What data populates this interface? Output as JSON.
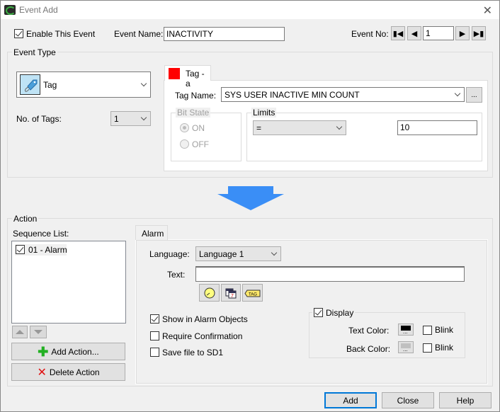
{
  "window": {
    "title": "Event Add",
    "close_icon": "close-icon"
  },
  "header": {
    "enable_label": "Enable This Event",
    "enable_checked": true,
    "event_name_label": "Event Name:",
    "event_name_value": "INACTIVITY",
    "event_no_label": "Event No:",
    "event_no_value": "1",
    "nav": {
      "first": "⏮",
      "prev": "◀",
      "next": "▶",
      "last": "⏭"
    }
  },
  "event_type": {
    "title": "Event Type",
    "type_value": "Tag",
    "type_icon": "tag-icon",
    "num_tags_label": "No. of Tags:",
    "num_tags_value": "1",
    "tab": {
      "label": "Tag - a",
      "color": "#ff0000"
    },
    "tag_name_label": "Tag Name:",
    "tag_name_value": "SYS USER INACTIVE MIN COUNT",
    "browse_label": "...",
    "bit_state": {
      "title": "Bit State",
      "on_label": "ON",
      "off_label": "OFF",
      "selected": "ON"
    },
    "limits": {
      "title": "Limits",
      "operator": "=",
      "value": "10"
    }
  },
  "arrow": {
    "color": "#3a8ef6"
  },
  "action": {
    "title": "Action",
    "sequence_label": "Sequence List:",
    "sequence_items": [
      {
        "label": "01 - Alarm",
        "checked": true
      }
    ],
    "add_action_label": "Add Action...",
    "delete_action_label": "Delete Action",
    "alarm_tab_label": "Alarm",
    "language_label": "Language:",
    "language_value": "Language 1",
    "text_label": "Text:",
    "text_value": "",
    "insert_icons": [
      "clock-icon",
      "calendar-icon",
      "tag-insert-icon"
    ],
    "options": [
      {
        "label": "Show in Alarm Objects",
        "checked": true
      },
      {
        "label": "Require Confirmation",
        "checked": false
      },
      {
        "label": "Save file to SD1",
        "checked": false
      }
    ],
    "display": {
      "label": "Display",
      "checked": true,
      "text_color_label": "Text Color:",
      "text_color": "#000000",
      "text_blink_label": "Blink",
      "text_blink": false,
      "back_color_label": "Back Color:",
      "back_color": "#c0c0c0",
      "back_blink_label": "Blink",
      "back_blink": false
    }
  },
  "footer": {
    "add_label": "Add",
    "close_label": "Close",
    "help_label": "Help"
  }
}
